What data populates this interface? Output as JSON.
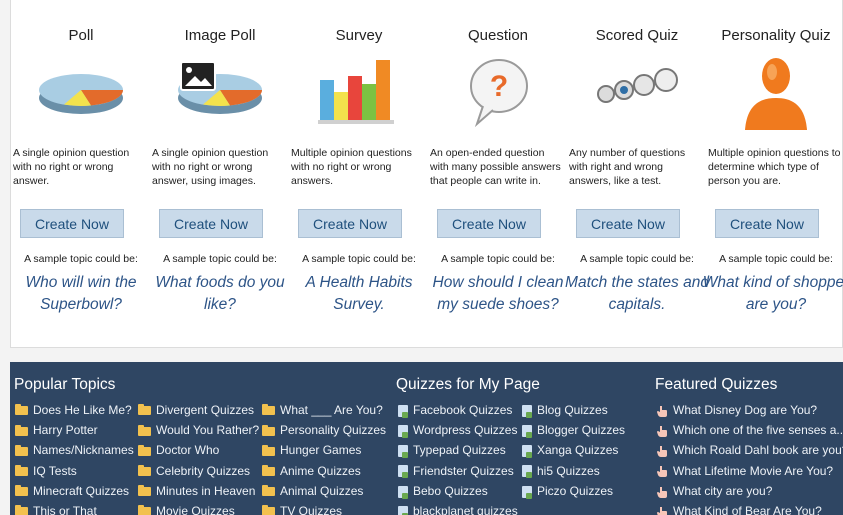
{
  "types": [
    {
      "title": "Poll",
      "icon": "pie-chart-icon",
      "desc": "A single opinion question with no right or wrong answer.",
      "button": "Create Now",
      "sample": "A sample topic could be:",
      "topic": "Who will win the Superbowl?"
    },
    {
      "title": "Image Poll",
      "icon": "image-pie-chart-icon",
      "desc": "A single opinion question with no right or wrong answer, using images.",
      "button": "Create Now",
      "sample": "A sample topic could be:",
      "topic": "What foods do you like?"
    },
    {
      "title": "Survey",
      "icon": "bar-chart-icon",
      "desc": "Multiple opinion questions with no right or wrong answers.",
      "button": "Create Now",
      "sample": "A sample topic could be:",
      "topic": "A Health Habits Survey."
    },
    {
      "title": "Question",
      "icon": "question-bubble-icon",
      "desc": "An open-ended question with many possible answers that people can write in.",
      "button": "Create Now",
      "sample": "A sample topic could be:",
      "topic": "How should I clean my suede shoes?"
    },
    {
      "title": "Scored Quiz",
      "icon": "radio-buttons-icon",
      "desc": "Any number of questions with right and wrong answers, like a test.",
      "button": "Create Now",
      "sample": "A sample topic could be:",
      "topic": "Match the states and capitals."
    },
    {
      "title": "Personality Quiz",
      "icon": "person-silhouette-icon",
      "desc": "Multiple opinion questions to determine which type of person you are.",
      "button": "Create Now",
      "sample": "A sample topic could be:",
      "topic": "What kind of shopper are you?"
    }
  ],
  "footer": {
    "popular": {
      "heading": "Popular Topics",
      "col1": [
        "Does He Like Me?",
        "Harry Potter",
        "Names/Nicknames",
        "IQ Tests",
        "Minecraft Quizzes",
        "This or That"
      ],
      "col2": [
        "Divergent Quizzes",
        "Would You Rather?",
        "Doctor Who",
        "Celebrity Quizzes",
        "Minutes in Heaven",
        "Movie Quizzes"
      ],
      "col3": [
        "What ___ Are You?",
        "Personality Quizzes",
        "Hunger Games",
        "Anime Quizzes",
        "Animal Quizzes",
        "TV Quizzes"
      ]
    },
    "mypage": {
      "heading": "Quizzes for My Page",
      "col1": [
        "Facebook Quizzes",
        "Wordpress Quizzes",
        "Typepad Quizzes",
        "Friendster Quizzes",
        "Bebo Quizzes",
        "blackplanet quizzes"
      ],
      "col2": [
        "Blog Quizzes",
        "Blogger Quizzes",
        "Xanga Quizzes",
        "hi5 Quizzes",
        "Piczo Quizzes"
      ]
    },
    "featured": {
      "heading": "Featured Quizzes",
      "items": [
        "What Disney Dog are You?",
        "Which one of the five senses a...",
        "Which Roald Dahl book are you?",
        "What Lifetime Movie Are You?",
        "What city are you?",
        "What Kind of Bear Are You?"
      ]
    }
  }
}
